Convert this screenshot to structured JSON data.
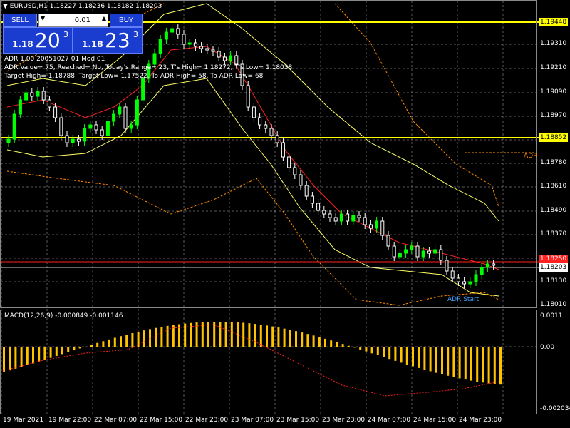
{
  "header": {
    "symbol_line": "EURUSD,H1  1.18227 1.18236 1.18182 1.18203"
  },
  "trade_panel": {
    "sell_label": "SELL",
    "buy_label": "BUY",
    "lot_value": "0.01",
    "sell_price_prefix": "1.18",
    "sell_price_big": "20",
    "sell_price_sup": "3",
    "buy_price_prefix": "1.18",
    "buy_price_big": "23",
    "buy_price_sup": "3"
  },
  "adr_info": {
    "line1": "ADR 1.00 20051027 01 Mod 01",
    "line2": "ADR Value= 75, Reached= No, Today's Range= 23, T's High= 1.18272, T's Low= 1.18038",
    "line3": "Target High= 1.18788, Target Low= 1.17522, To ADR High= 58, To ADR Low= 68"
  },
  "price_axis": [
    "1.19310",
    "1.19210",
    "1.19090",
    "1.18970",
    "1.18780",
    "1.18610",
    "1.18490",
    "1.18370",
    "1.18130",
    "1.18010"
  ],
  "price_tags": {
    "level_high": "1.19448",
    "level_mid": "1.18852",
    "current": "1.18203",
    "red_line": "1.18250"
  },
  "annotations": {
    "adr_right": "ADR",
    "adr_start": "ADR Start"
  },
  "macd": {
    "label": "MACD(12,26,9) -0.000849 -0.001146",
    "axis_top": "0.0011",
    "axis_zero": "0.00",
    "axis_bottom": "-0.002034"
  },
  "time_axis": [
    "19 Mar 2021",
    "19 Mar 22:00",
    "22 Mar 07:00",
    "22 Mar 15:00",
    "22 Mar 23:00",
    "23 Mar 07:00",
    "23 Mar 15:00",
    "23 Mar 23:00",
    "24 Mar 07:00",
    "24 Mar 15:00",
    "24 Mar 23:00"
  ],
  "colors": {
    "background": "#000000",
    "grid": "#ffffff",
    "bull_candle": "#00ff00",
    "bear_candle": "#ffffff",
    "ma_red": "#ff2020",
    "band_yellow": "#ffff66",
    "level_line": "#ffff00",
    "macd_bar": "#ffc200",
    "panel_blue": "#1a3ccf"
  }
}
